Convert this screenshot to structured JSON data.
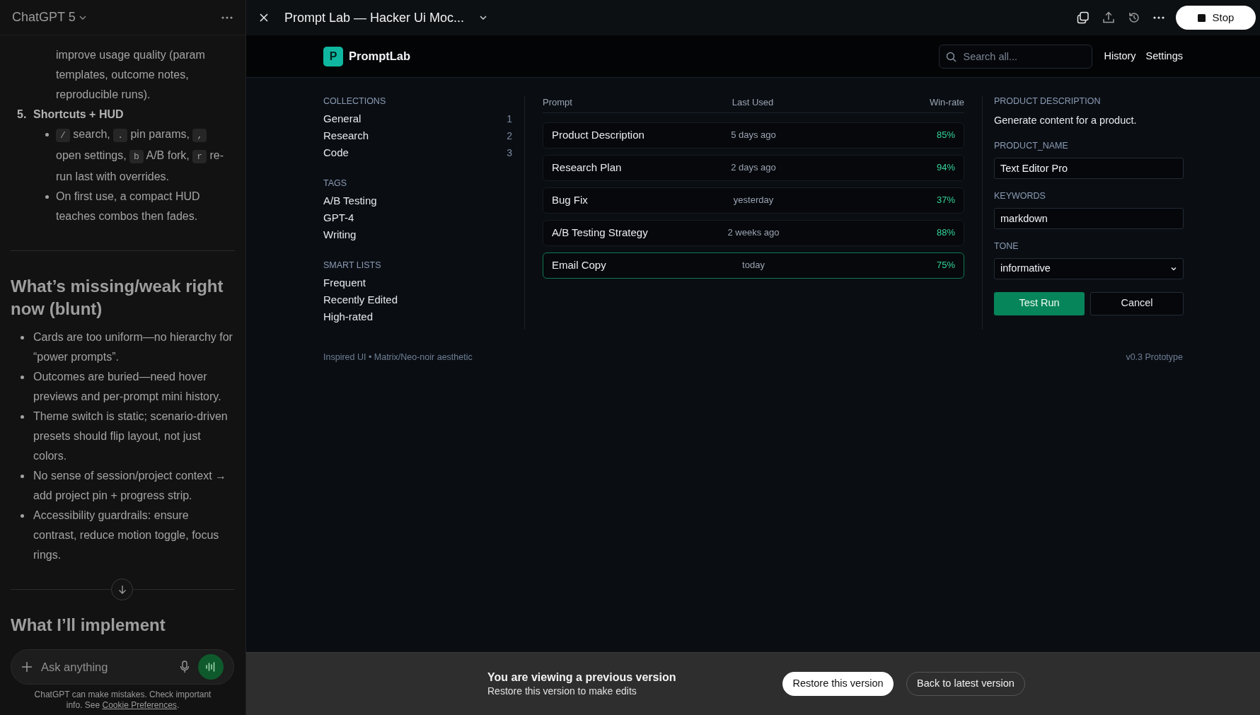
{
  "chat": {
    "model": "ChatGPT 5",
    "content": [
      {
        "kind": "continuation",
        "text": "improve usage quality (param templates, outcome notes, reproducible runs)."
      },
      {
        "kind": "numbered",
        "number": "5.",
        "text": "Shortcuts + HUD",
        "children": [
          {
            "parts": [
              {
                "kind": "kbd",
                "text": "/"
              },
              {
                "kind": "text",
                "text": " search, "
              },
              {
                "kind": "kbd",
                "text": "."
              },
              {
                "kind": "text",
                "text": " pin params, "
              },
              {
                "kind": "kbd",
                "text": ","
              },
              {
                "kind": "text",
                "text": " open settings, "
              },
              {
                "kind": "kbd",
                "text": "b"
              },
              {
                "kind": "text",
                "text": " A/B fork, "
              },
              {
                "kind": "kbd",
                "text": "r"
              },
              {
                "kind": "text",
                "text": " re-run last with overrides."
              }
            ]
          },
          {
            "parts": [
              {
                "kind": "text",
                "text": "On first use, a compact HUD teaches combos then fades."
              }
            ]
          }
        ]
      },
      {
        "kind": "rule"
      },
      {
        "kind": "heading",
        "text": "What’s missing/weak right now (blunt)"
      },
      {
        "kind": "bullets",
        "items": [
          "Cards are too uniform—no hierarchy for “power prompts”.",
          "Outcomes are buried—need hover previews and per-prompt mini history.",
          "Theme switch is static; scenario-driven presets should flip layout, not just colors.",
          "No sense of session/project context → add project pin + progress strip.",
          "Accessibility guardrails: ensure contrast, reduce motion toggle, focus rings."
        ]
      },
      {
        "kind": "rule"
      },
      {
        "kind": "heading",
        "text": "What I’ll implement"
      }
    ],
    "input": {
      "placeholder": "Ask anything"
    },
    "disclaimer": "ChatGPT can make mistakes. Check important info. See ",
    "disclaimer_link": "Cookie Preferences",
    "disclaimer_end": "."
  },
  "artifact": {
    "title": "Prompt Lab — Hacker Ui Moc...",
    "stop_label": "Stop"
  },
  "app": {
    "logo": "P",
    "brand": "PromptLab",
    "search": {
      "placeholder": "Search all..."
    },
    "nav": [
      "History",
      "Settings"
    ],
    "sidebar": [
      {
        "title": "COLLECTIONS",
        "items": [
          {
            "label": "General",
            "count": "1"
          },
          {
            "label": "Research",
            "count": "2"
          },
          {
            "label": "Code",
            "count": "3"
          }
        ]
      },
      {
        "title": "TAGS",
        "items": [
          {
            "label": "A/B Testing"
          },
          {
            "label": "GPT-4"
          },
          {
            "label": "Writing"
          }
        ]
      },
      {
        "title": "SMART LISTS",
        "items": [
          {
            "label": "Frequent"
          },
          {
            "label": "Recently Edited"
          },
          {
            "label": "High-rated"
          }
        ]
      }
    ],
    "table": {
      "columns": [
        "Prompt",
        "Last Used",
        "Win-rate"
      ],
      "rows": [
        {
          "prompt": "Product Description",
          "last_used": "5 days ago",
          "win_rate": "85%",
          "highlighted": false
        },
        {
          "prompt": "Research Plan",
          "last_used": "2 days ago",
          "win_rate": "94%",
          "highlighted": false
        },
        {
          "prompt": "Bug Fix",
          "last_used": "yesterday",
          "win_rate": "37%",
          "highlighted": false
        },
        {
          "prompt": "A/B Testing Strategy",
          "last_used": "2 weeks ago",
          "win_rate": "88%",
          "highlighted": false
        },
        {
          "prompt": "Email Copy",
          "last_used": "today",
          "win_rate": "75%",
          "highlighted": true
        }
      ]
    },
    "detail": {
      "title": "PRODUCT DESCRIPTION",
      "description": "Generate content for a product.",
      "fields": [
        {
          "label": "PRODUCT_NAME",
          "kind": "text",
          "value": "Text Editor Pro"
        },
        {
          "label": "KEYWORDS",
          "kind": "text",
          "value": "markdown"
        },
        {
          "label": "TONE",
          "kind": "select",
          "value": "informative"
        }
      ],
      "buttons": [
        {
          "label": "Test Run",
          "kind": "primary"
        },
        {
          "label": "Cancel",
          "kind": "secondary"
        }
      ]
    },
    "footer": {
      "left": "Inspired UI • Matrix/Neo-noir aesthetic",
      "right": "v0.3 Prototype"
    }
  },
  "banner": {
    "title": "You are viewing a previous version",
    "subtitle": "Restore this version to make edits",
    "buttons": [
      {
        "label": "Restore this version",
        "kind": "primary"
      },
      {
        "label": "Back to latest version",
        "kind": "secondary"
      }
    ]
  }
}
